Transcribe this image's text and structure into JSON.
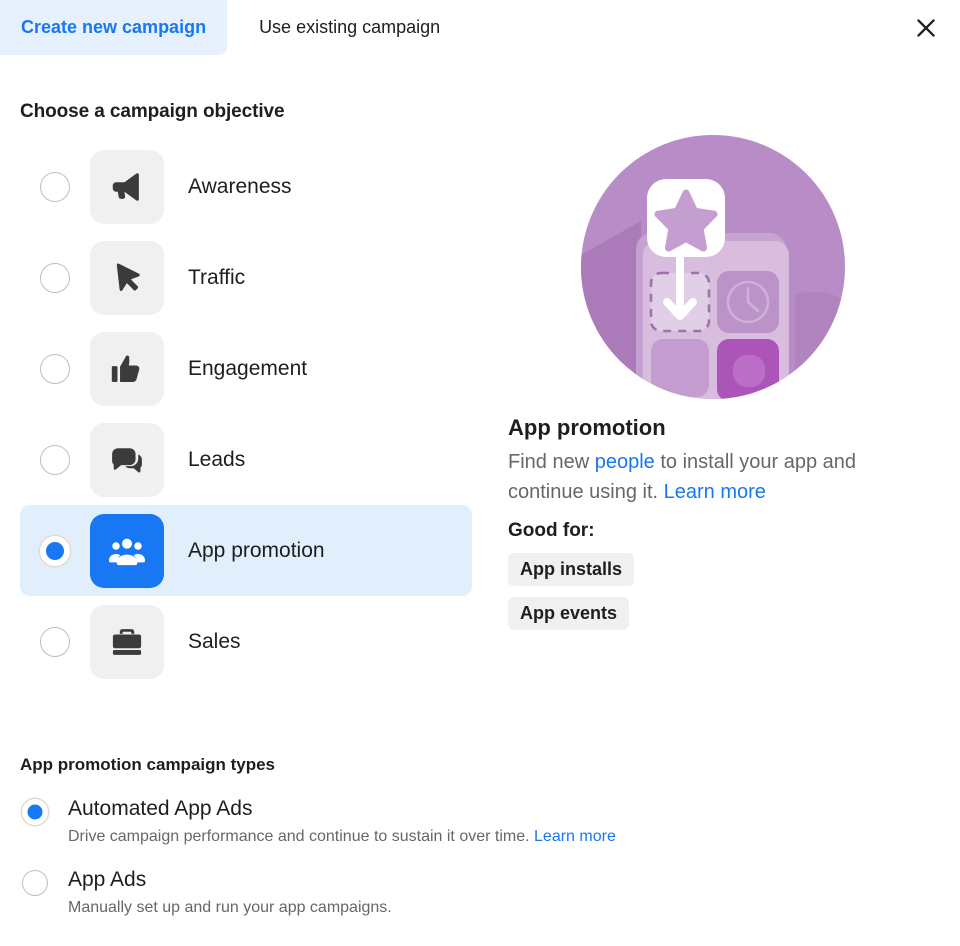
{
  "tabs": [
    {
      "label": "Create new campaign",
      "active": true
    },
    {
      "label": "Use existing campaign",
      "active": false
    }
  ],
  "close_icon": "close-icon",
  "colors": {
    "accent_blue": "#1877f2",
    "selected_row_bg": "#e1effd",
    "tab_active_bg": "#e7f0fd",
    "tile_bg": "#f0f0f0",
    "illustration_purple": "#b88cc6",
    "muted_text": "#65676b"
  },
  "objective": {
    "heading": "Choose a campaign objective",
    "options": [
      {
        "label": "Awareness",
        "icon": "megaphone-icon",
        "selected": false
      },
      {
        "label": "Traffic",
        "icon": "cursor-icon",
        "selected": false
      },
      {
        "label": "Engagement",
        "icon": "thumbs-up-icon",
        "selected": false
      },
      {
        "label": "Leads",
        "icon": "chat-bubbles-icon",
        "selected": false
      },
      {
        "label": "App promotion",
        "icon": "people-group-icon",
        "selected": true
      },
      {
        "label": "Sales",
        "icon": "briefcase-icon",
        "selected": false
      }
    ]
  },
  "detail": {
    "illustration": "app-promotion-illustration",
    "title": "App promotion",
    "desc_part1": "Find new ",
    "desc_link1": "people",
    "desc_part2": " to install your app and continue using it. ",
    "desc_link2": "Learn more",
    "good_for_label": "Good for:",
    "chips": [
      "App installs",
      "App events"
    ]
  },
  "campaign_types": {
    "heading": "App promotion campaign types",
    "options": [
      {
        "name": "Automated App Ads",
        "desc": "Drive campaign performance and continue to sustain it over time. ",
        "link": "Learn more",
        "selected": true
      },
      {
        "name": "App Ads",
        "desc": "Manually set up and run your app campaigns.",
        "link": "",
        "selected": false
      }
    ]
  }
}
